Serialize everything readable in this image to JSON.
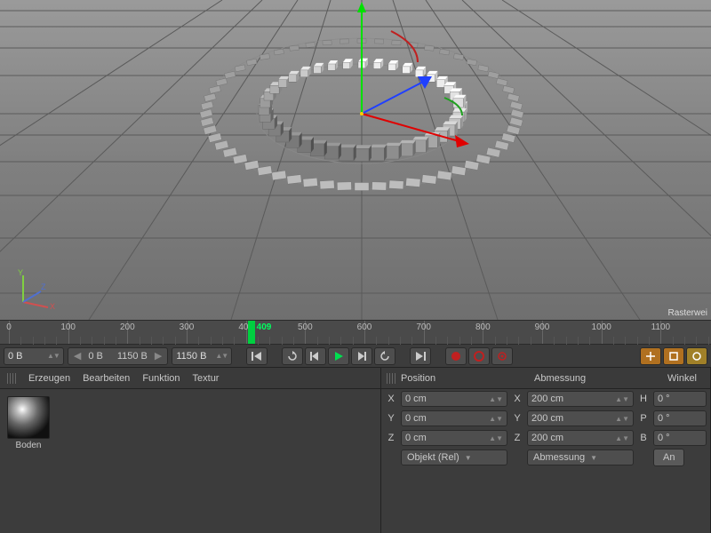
{
  "viewport": {
    "status_right": "Rasterwei",
    "gizmo": {
      "x": "X",
      "y": "Y",
      "z": "Z"
    }
  },
  "timeline": {
    "ticks": [
      0,
      100,
      200,
      300,
      400,
      500,
      600,
      700,
      800,
      900,
      1000,
      1100
    ],
    "playhead": 409,
    "start_field": "0 B",
    "range_start": "0 B",
    "range_end": "1150 B",
    "end_field": "1150 B"
  },
  "material_panel": {
    "menu": {
      "create": "Erzeugen",
      "edit": "Bearbeiten",
      "func": "Funktion",
      "texture": "Textur"
    },
    "item_name": "Boden"
  },
  "coords": {
    "headers": {
      "position": "Position",
      "dimension": "Abmessung",
      "angle": "Winkel"
    },
    "rows": [
      {
        "axis": "X",
        "pos": "0 cm",
        "dim": "200 cm",
        "angkey": "H",
        "ang": "0 °"
      },
      {
        "axis": "Y",
        "pos": "0 cm",
        "dim": "200 cm",
        "angkey": "P",
        "ang": "0 °"
      },
      {
        "axis": "Z",
        "pos": "0 cm",
        "dim": "200 cm",
        "angkey": "B",
        "ang": "0 °"
      }
    ],
    "dropdowns": {
      "mode": "Objekt (Rel)",
      "dim_mode": "Abmessung"
    },
    "apply": "An"
  }
}
